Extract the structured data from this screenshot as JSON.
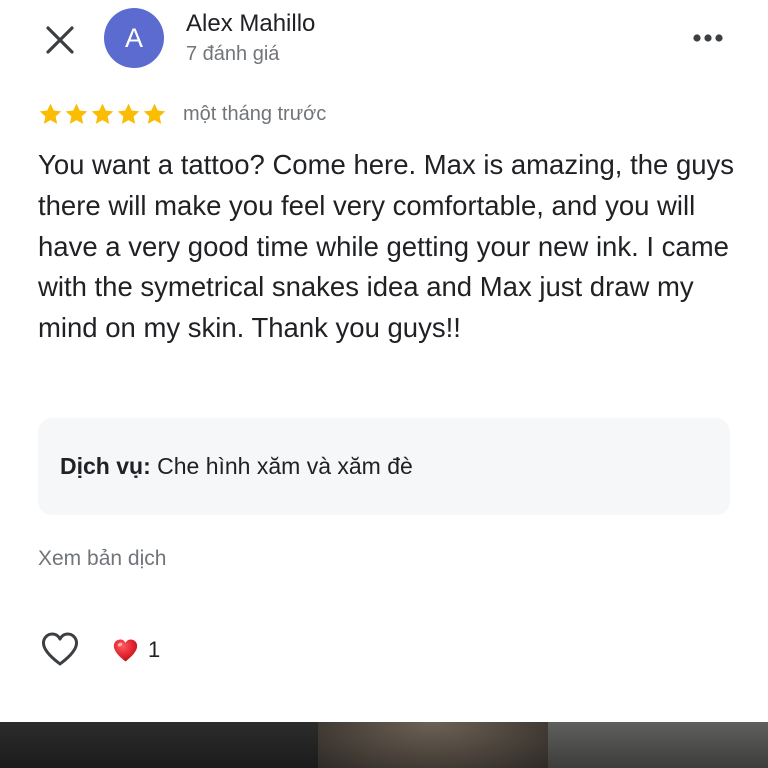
{
  "header": {
    "close_icon": "close-icon",
    "avatar_letter": "A",
    "avatar_color": "#5b6bcf",
    "author_name": "Alex Mahillo",
    "author_meta": "7 đánh giá",
    "more_icon": "more-horizontal-icon"
  },
  "review": {
    "rating": 5,
    "rating_max": 5,
    "star_color": "#fbbc04",
    "time": "một tháng trước",
    "text": "You want a tattoo? Come here. Max is amazing, the guys there will make you feel very comfortable, and you will have a very good time while getting your new ink. I came with the symetrical snakes idea and Max just draw my mind on my skin. Thank you guys!!"
  },
  "service": {
    "label": "Dịch vụ:",
    "value": "Che hình xăm và xăm đè"
  },
  "translate_link": "Xem bản dịch",
  "actions": {
    "like_icon": "heart-outline-icon",
    "reaction_icon": "red-heart-icon",
    "reaction_count": "1"
  },
  "media": {
    "photo": "review-photo"
  }
}
